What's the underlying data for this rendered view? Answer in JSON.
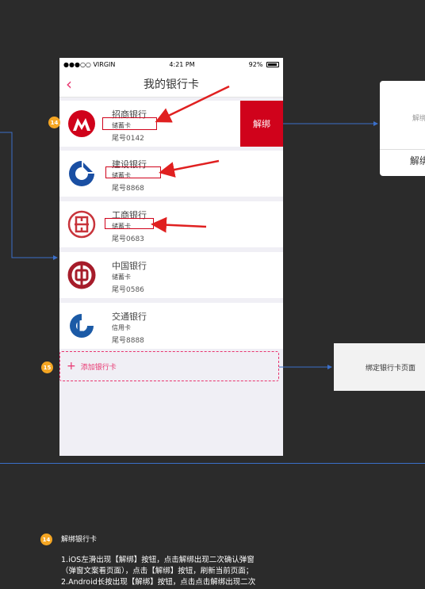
{
  "status": {
    "carrier": "●●●○○ VIRGIN",
    "time": "4:21 PM",
    "battery": "92%"
  },
  "nav": {
    "back": "‹",
    "title": "我的银行卡"
  },
  "cards": [
    {
      "name": "招商银行",
      "type": "储蓄卡",
      "tail": "尾号0142",
      "logo": "cmb-logo",
      "color": "#d0021b"
    },
    {
      "name": "建设银行",
      "type": "储蓄卡",
      "tail": "尾号8868",
      "logo": "ccb-logo",
      "color": "#1a4fa3"
    },
    {
      "name": "工商银行",
      "type": "储蓄卡",
      "tail": "尾号0683",
      "logo": "icbc-logo",
      "color": "#c8343b"
    },
    {
      "name": "中国银行",
      "type": "储蓄卡",
      "tail": "尾号0586",
      "logo": "boc-logo",
      "color": "#a61c2a"
    },
    {
      "name": "交通银行",
      "type": "信用卡",
      "tail": "尾号8888",
      "logo": "bocom-logo",
      "color": "#1b5aa6"
    }
  ],
  "unbind_label": "解绑",
  "add_bank": {
    "plus": "+",
    "label": "添加银行卡"
  },
  "badges": {
    "b14": "14",
    "b15": "15"
  },
  "popup": {
    "text": "解绑",
    "button": "解绑"
  },
  "bind_page": "绑定银行卡页面",
  "note": {
    "badge": "14",
    "title": "解绑银行卡",
    "lines": [
      "1.iOS左滑出现【解绑】按钮，点击解绑出现二次确认弹窗",
      "（弹窗文案看页面），点击【解绑】按钮，刷新当前页面；",
      "2.Android长按出现【解绑】按钮，点击点击解绑出现二次"
    ]
  }
}
